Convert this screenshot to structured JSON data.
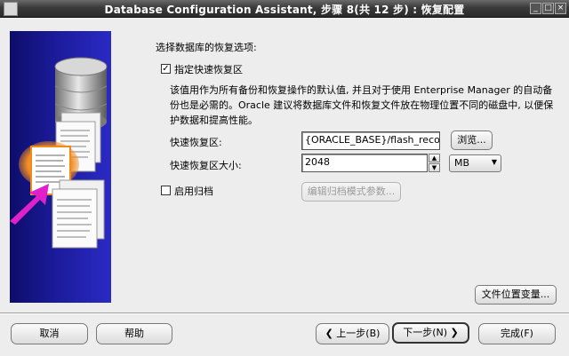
{
  "window": {
    "title": "Database Configuration Assistant, 步骤 8(共 12 步) : 恢复配置",
    "minimize": "_",
    "maximize": "□",
    "close": "×"
  },
  "form": {
    "heading": "选择数据库的恢复选项:",
    "fast_recovery_checkbox": {
      "label": "指定快速恢复区",
      "checked": true,
      "mark": "✓"
    },
    "description": "该值用作为所有备份和恢复操作的默认值, 并且对于使用 Enterprise Manager 的自动备份也是必需的。Oracle 建议将数据库文件和恢复文件放在物理位置不同的磁盘中, 以便保护数据和提高性能。",
    "recovery_area_label": "快速恢复区:",
    "recovery_area_value": "{ORACLE_BASE}/flash_recovery_a",
    "browse_button": "浏览...",
    "recovery_size_label": "快速恢复区大小:",
    "recovery_size_value": "2048",
    "spin_up": "▲",
    "spin_down": "▼",
    "size_unit": "MB",
    "unit_caret": "▼",
    "archive_checkbox": {
      "label": "启用归档",
      "checked": false
    },
    "archive_params_button": "编辑归档模式参数...",
    "file_location_button": "文件位置变量..."
  },
  "footer": {
    "cancel": "取消",
    "help": "帮助",
    "back": "上一步(B)",
    "back_arrow": "❮",
    "next": "下一步(N)",
    "next_arrow": "❯",
    "finish": "完成(F)"
  }
}
